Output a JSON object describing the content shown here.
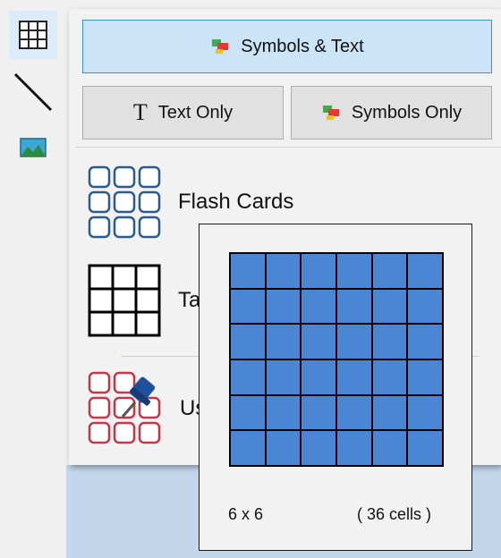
{
  "toolbar": {
    "items": [
      {
        "name": "table-grid-icon"
      },
      {
        "name": "line-tool-icon"
      },
      {
        "name": "image-icon"
      }
    ]
  },
  "menu": {
    "symbols_text_label": "Symbols & Text",
    "text_only_label": "Text Only",
    "text_only_glyph": "T",
    "symbols_only_label": "Symbols Only",
    "items": [
      {
        "label": "Flash Cards",
        "icon": "flash-cards-icon"
      },
      {
        "label": "Ta",
        "icon": "table-icon"
      },
      {
        "label": "Us",
        "icon": "user-templates-icon"
      }
    ]
  },
  "preview": {
    "size_label": "6 x 6",
    "cells_label": "( 36 cells )",
    "rows": 6,
    "cols": 6,
    "cell_color": "#4b86d4"
  },
  "colors": {
    "accent_border": "#3d8fd6",
    "accent_fill": "#cce4f7",
    "flash_blue": "#2c5a8c",
    "user_red": "#c0394b"
  }
}
